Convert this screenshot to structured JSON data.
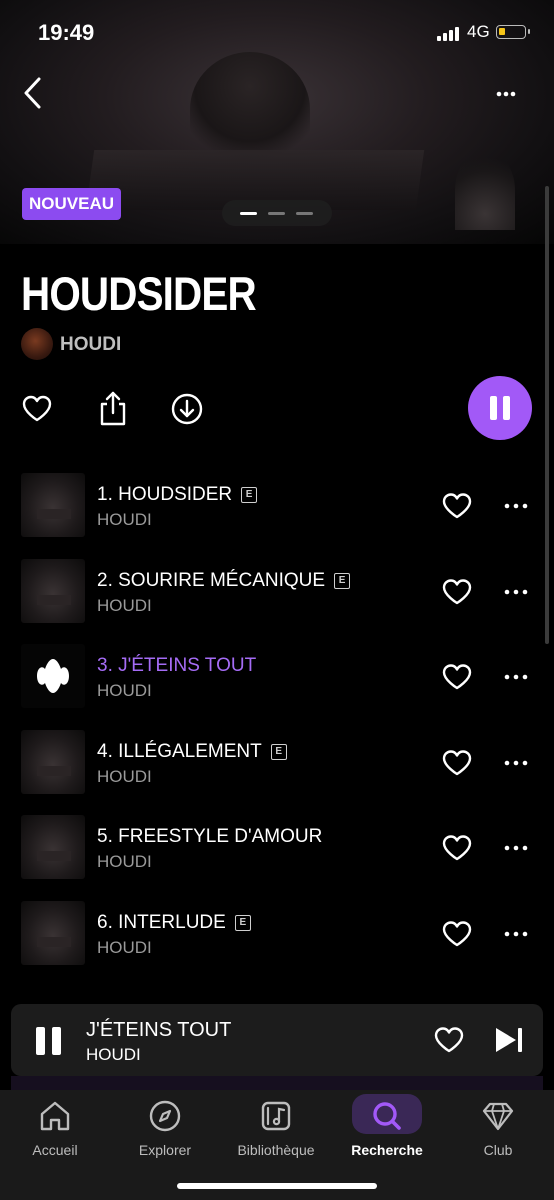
{
  "status_bar": {
    "time": "19:49",
    "network": "4G"
  },
  "album": {
    "badge": "NOUVEAU",
    "title": "HOUDSIDER",
    "artist": "HOUDI"
  },
  "tracks": [
    {
      "title": "1. HOUDSIDER",
      "artist": "HOUDI",
      "explicit": true,
      "playing": false
    },
    {
      "title": "2. SOURIRE MÉCANIQUE",
      "artist": "HOUDI",
      "explicit": true,
      "playing": false
    },
    {
      "title": "3. J'ÉTEINS TOUT",
      "artist": "HOUDI",
      "explicit": false,
      "playing": true
    },
    {
      "title": "4. ILLÉGALEMENT",
      "artist": "HOUDI",
      "explicit": true,
      "playing": false
    },
    {
      "title": "5. FREESTYLE D'AMOUR",
      "artist": "HOUDI",
      "explicit": false,
      "playing": false
    },
    {
      "title": "6. INTERLUDE",
      "artist": "HOUDI",
      "explicit": true,
      "playing": false
    }
  ],
  "explicit_label": "E",
  "mini_player": {
    "title": "J'ÉTEINS TOUT",
    "artist": "HOUDI"
  },
  "tabs": [
    {
      "label": "Accueil",
      "icon": "home-icon",
      "active": false
    },
    {
      "label": "Explorer",
      "icon": "compass-icon",
      "active": false
    },
    {
      "label": "Bibliothèque",
      "icon": "library-icon",
      "active": false
    },
    {
      "label": "Recherche",
      "icon": "search-icon",
      "active": true
    },
    {
      "label": "Club",
      "icon": "diamond-icon",
      "active": false
    }
  ],
  "colors": {
    "accent": "#a259f7",
    "badge": "#8c4bf0",
    "battery": "#f5c518"
  }
}
